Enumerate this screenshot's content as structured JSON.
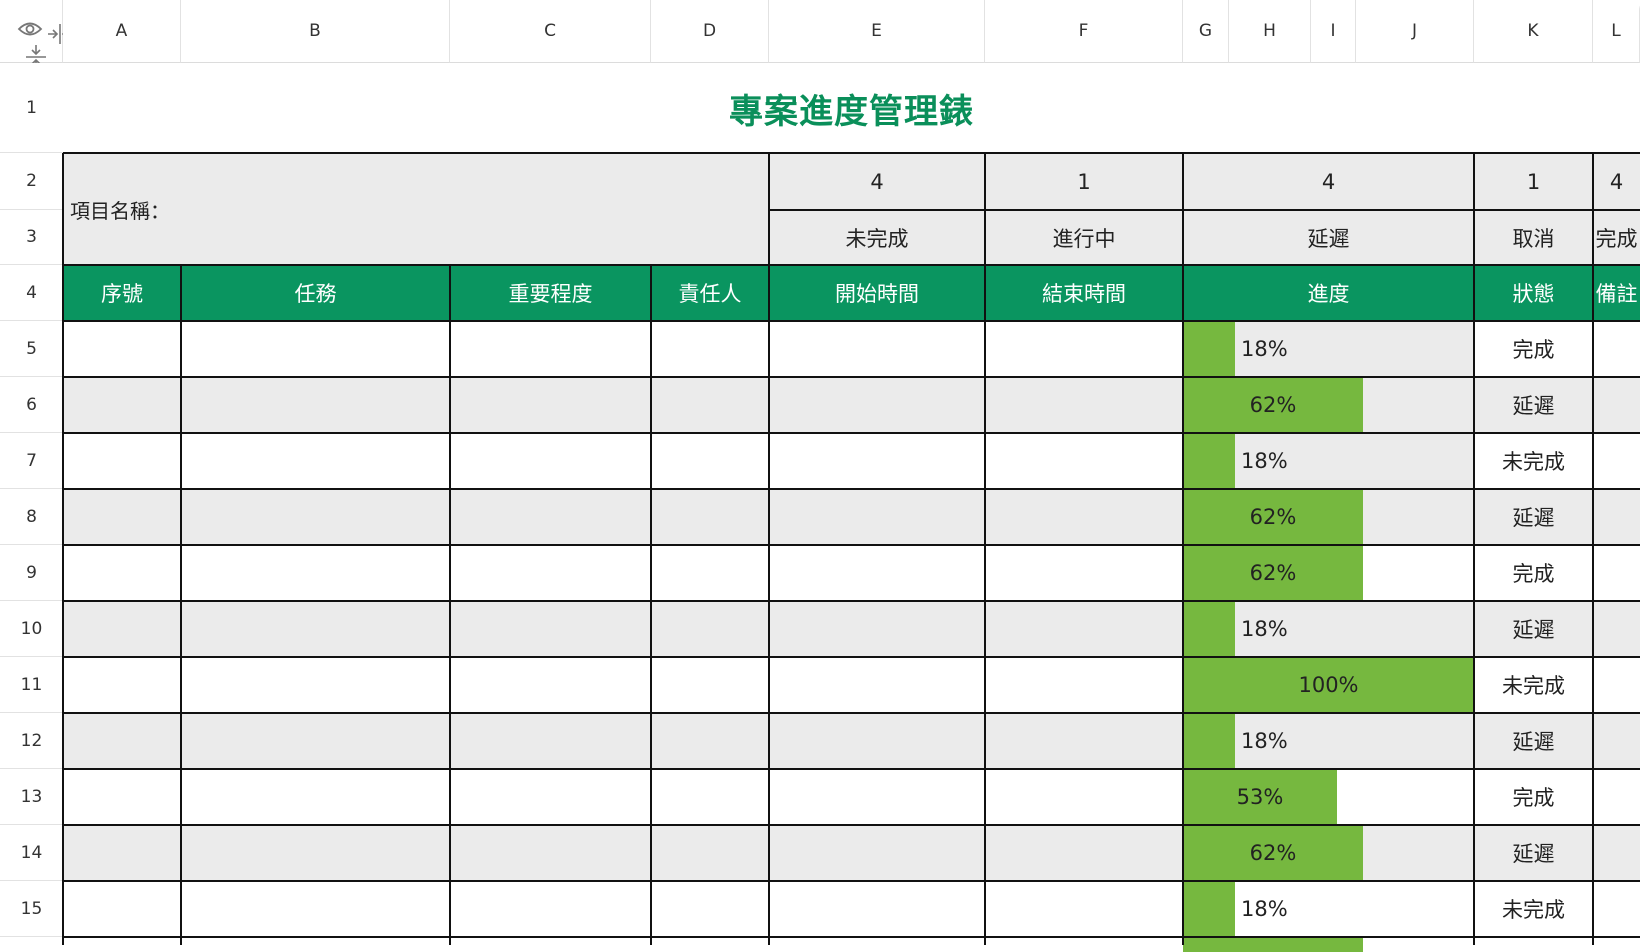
{
  "columns": [
    "A",
    "B",
    "C",
    "D",
    "E",
    "F",
    "G",
    "H",
    "I",
    "J",
    "K",
    "L"
  ],
  "rows": [
    "1",
    "2",
    "3",
    "4",
    "5",
    "6",
    "7",
    "8",
    "9",
    "10",
    "11",
    "12",
    "13",
    "14",
    "15"
  ],
  "sheet": {
    "title": "專案進度管理錶",
    "project_label": "項目名稱：",
    "counts": [
      "4",
      "1",
      "4",
      "1",
      "4"
    ],
    "status_labels": [
      "未完成",
      "進行中",
      "延遲",
      "取消",
      "完成"
    ],
    "headers": [
      "序號",
      "任務",
      "重要程度",
      "責任人",
      "開始時間",
      "結束時間",
      "進度",
      "狀態",
      "備註"
    ],
    "data_rows": [
      {
        "progress": 0.18,
        "progress_label": "18%",
        "status": "完成"
      },
      {
        "progress": 0.62,
        "progress_label": "62%",
        "status": "延遲"
      },
      {
        "progress": 0.18,
        "progress_label": "18%",
        "status": "未完成"
      },
      {
        "progress": 0.62,
        "progress_label": "62%",
        "status": "延遲"
      },
      {
        "progress": 0.62,
        "progress_label": "62%",
        "status": "完成"
      },
      {
        "progress": 0.18,
        "progress_label": "18%",
        "status": "延遲"
      },
      {
        "progress": 1.0,
        "progress_label": "100%",
        "status": "未完成"
      },
      {
        "progress": 0.18,
        "progress_label": "18%",
        "status": "延遲"
      },
      {
        "progress": 0.53,
        "progress_label": "53%",
        "status": "完成"
      },
      {
        "progress": 0.62,
        "progress_label": "62%",
        "status": "延遲"
      },
      {
        "progress": 0.18,
        "progress_label": "18%",
        "status": "未完成"
      }
    ]
  },
  "colors": {
    "title": "#0a8f5a",
    "header_fill": "#0a9560",
    "alt_row_fill": "#ebebeb",
    "progress_bar": "#76b83f"
  },
  "icons": {
    "show_hide": "eye-icon",
    "freeze_columns": "freeze-columns-icon",
    "freeze_rows": "freeze-rows-icon"
  }
}
